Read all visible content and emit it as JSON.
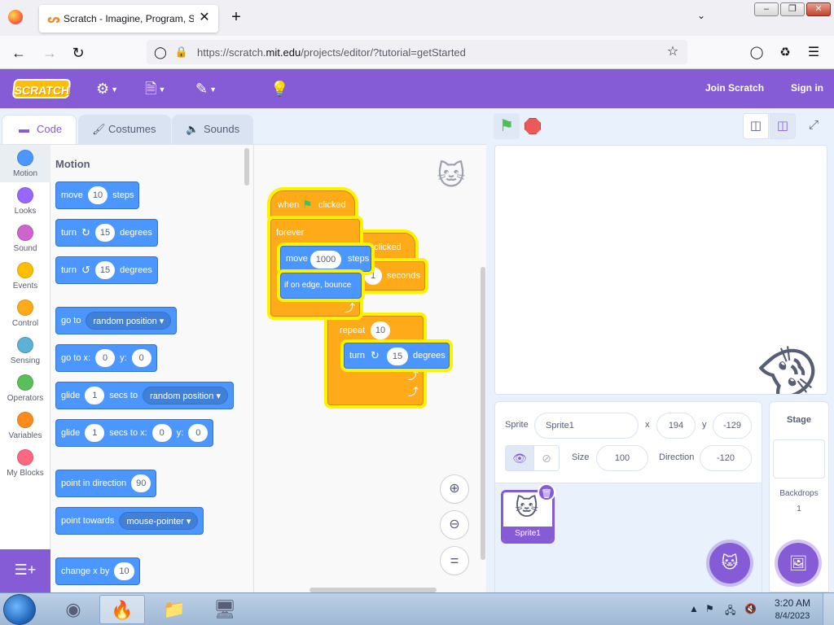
{
  "browser": {
    "tab_title": "Scratch - Imagine, Program, Share",
    "tab_close": "✕",
    "new_tab": "+",
    "url_prefix": "https://scratch.",
    "url_domain": "mit.edu",
    "url_path": "/projects/editor/?tutorial=getStarted"
  },
  "menubar": {
    "logo": "SCRATCH",
    "join": "Join Scratch",
    "signin": "Sign in"
  },
  "tabs": {
    "code": "Code",
    "costumes": "Costumes",
    "sounds": "Sounds"
  },
  "categories": [
    {
      "label": "Motion",
      "color": "#4c97ff"
    },
    {
      "label": "Looks",
      "color": "#9966ff"
    },
    {
      "label": "Sound",
      "color": "#cf63cf"
    },
    {
      "label": "Events",
      "color": "#ffbf00"
    },
    {
      "label": "Control",
      "color": "#ffab19"
    },
    {
      "label": "Sensing",
      "color": "#5cb1d6"
    },
    {
      "label": "Operators",
      "color": "#59c059"
    },
    {
      "label": "Variables",
      "color": "#ff8c1a"
    },
    {
      "label": "My Blocks",
      "color": "#ff6680"
    }
  ],
  "palette": {
    "heading": "Motion",
    "move": {
      "a": "move",
      "v": "10",
      "b": "steps"
    },
    "turn_right": {
      "a": "turn",
      "v": "15",
      "b": "degrees"
    },
    "turn_left": {
      "a": "turn",
      "v": "15",
      "b": "degrees"
    },
    "goto": {
      "a": "go to",
      "d": "random position"
    },
    "goto_xy": {
      "a": "go to x:",
      "x": "0",
      "b": "y:",
      "y": "0"
    },
    "glide": {
      "a": "glide",
      "v": "1",
      "b": "secs to",
      "d": "random position"
    },
    "glide_xy": {
      "a": "glide",
      "v": "1",
      "b": "secs to x:",
      "x": "0",
      "c": "y:",
      "y": "0"
    },
    "point_dir": {
      "a": "point in direction",
      "v": "90"
    },
    "point_towards": {
      "a": "point towards",
      "d": "mouse-pointer"
    },
    "change_x": {
      "a": "change x by",
      "v": "10"
    }
  },
  "script": {
    "hat1": {
      "a": "when",
      "b": "clicked"
    },
    "forever": "forever",
    "move": {
      "a": "move",
      "v": "1000",
      "b": "steps"
    },
    "bounce": "if on edge, bounce",
    "hat2_b": "clicked",
    "wait_v": "1",
    "wait_b": "seconds",
    "repeat": {
      "a": "repeat",
      "v": "10"
    },
    "turn": {
      "a": "turn",
      "v": "15",
      "b": "degrees"
    }
  },
  "sprite_info": {
    "sprite_label": "Sprite",
    "name": "Sprite1",
    "x_label": "x",
    "x": "194",
    "y_label": "y",
    "y": "-129",
    "size_label": "Size",
    "size": "100",
    "direction_label": "Direction",
    "direction": "-120"
  },
  "sprite_list": [
    {
      "name": "Sprite1"
    }
  ],
  "stage_pane": {
    "title": "Stage",
    "backdrops_label": "Backdrops",
    "backdrops_count": "1"
  },
  "taskbar": {
    "time": "3:20 AM",
    "date": "8/4/2023"
  }
}
